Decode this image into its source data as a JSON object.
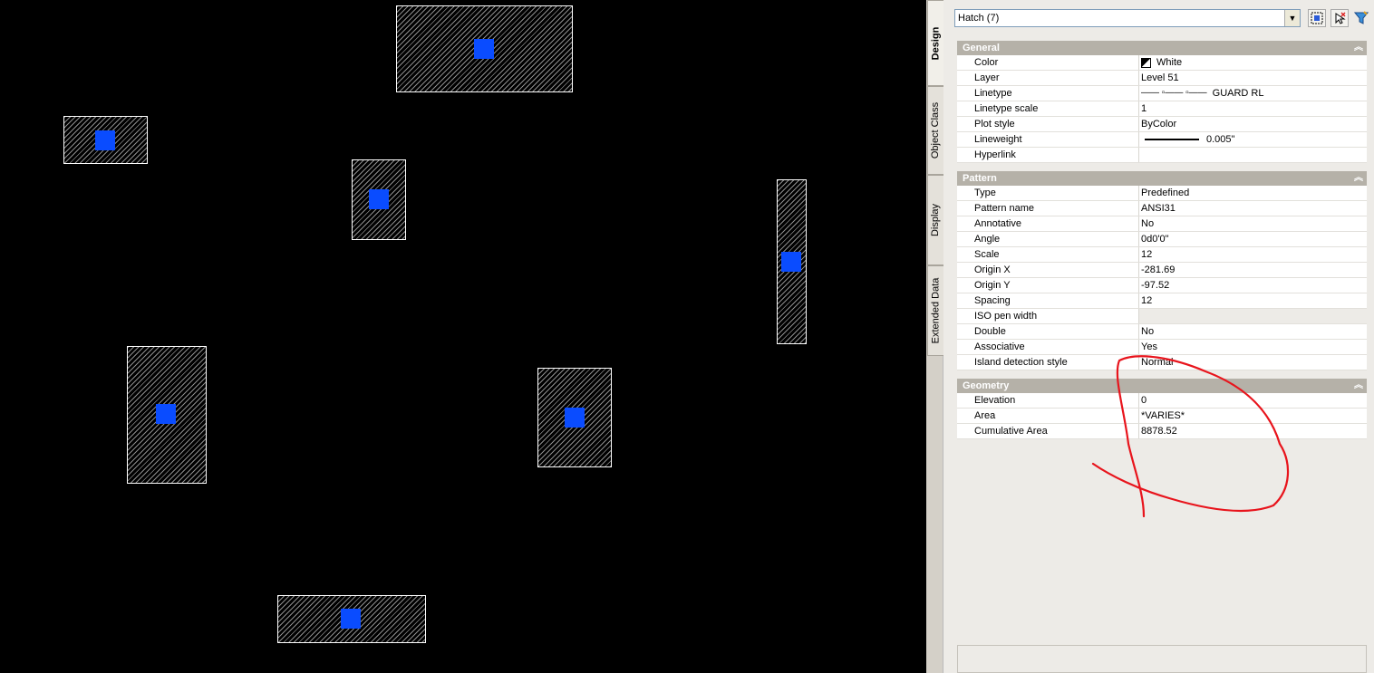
{
  "drawing": {
    "hatch_count": 7
  },
  "selector": {
    "value": "Hatch (7)"
  },
  "toolbar": {
    "quick_select_icon": "quick-select-icon",
    "pickadd_icon": "select-objects-icon",
    "filter_icon": "filter-icon"
  },
  "tabs": [
    "Design",
    "Object Class",
    "Display",
    "Extended Data"
  ],
  "sections": {
    "general": {
      "title": "General",
      "rows": [
        {
          "k": "Color",
          "v": "White"
        },
        {
          "k": "Layer",
          "v": "Level 51"
        },
        {
          "k": "Linetype",
          "v": "GUARD RL"
        },
        {
          "k": "Linetype scale",
          "v": "1"
        },
        {
          "k": "Plot style",
          "v": "ByColor"
        },
        {
          "k": "Lineweight",
          "v": "0.005\""
        },
        {
          "k": "Hyperlink",
          "v": ""
        }
      ]
    },
    "pattern": {
      "title": "Pattern",
      "rows": [
        {
          "k": "Type",
          "v": "Predefined"
        },
        {
          "k": "Pattern name",
          "v": "ANSI31"
        },
        {
          "k": "Annotative",
          "v": "No"
        },
        {
          "k": "Angle",
          "v": "0d0'0\""
        },
        {
          "k": "Scale",
          "v": "12"
        },
        {
          "k": "Origin X",
          "v": "-281.69"
        },
        {
          "k": "Origin Y",
          "v": "-97.52"
        },
        {
          "k": "Spacing",
          "v": "12"
        },
        {
          "k": "ISO pen width",
          "v": ""
        },
        {
          "k": "Double",
          "v": "No"
        },
        {
          "k": "Associative",
          "v": "Yes"
        },
        {
          "k": "Island detection style",
          "v": "Normal"
        }
      ]
    },
    "geometry": {
      "title": "Geometry",
      "rows": [
        {
          "k": "Elevation",
          "v": "0"
        },
        {
          "k": "Area",
          "v": "*VARIES*"
        },
        {
          "k": "Cumulative Area",
          "v": "8878.52"
        }
      ]
    }
  },
  "colors": {
    "grip": "#0a4cff",
    "annotation": "#e8141c"
  }
}
